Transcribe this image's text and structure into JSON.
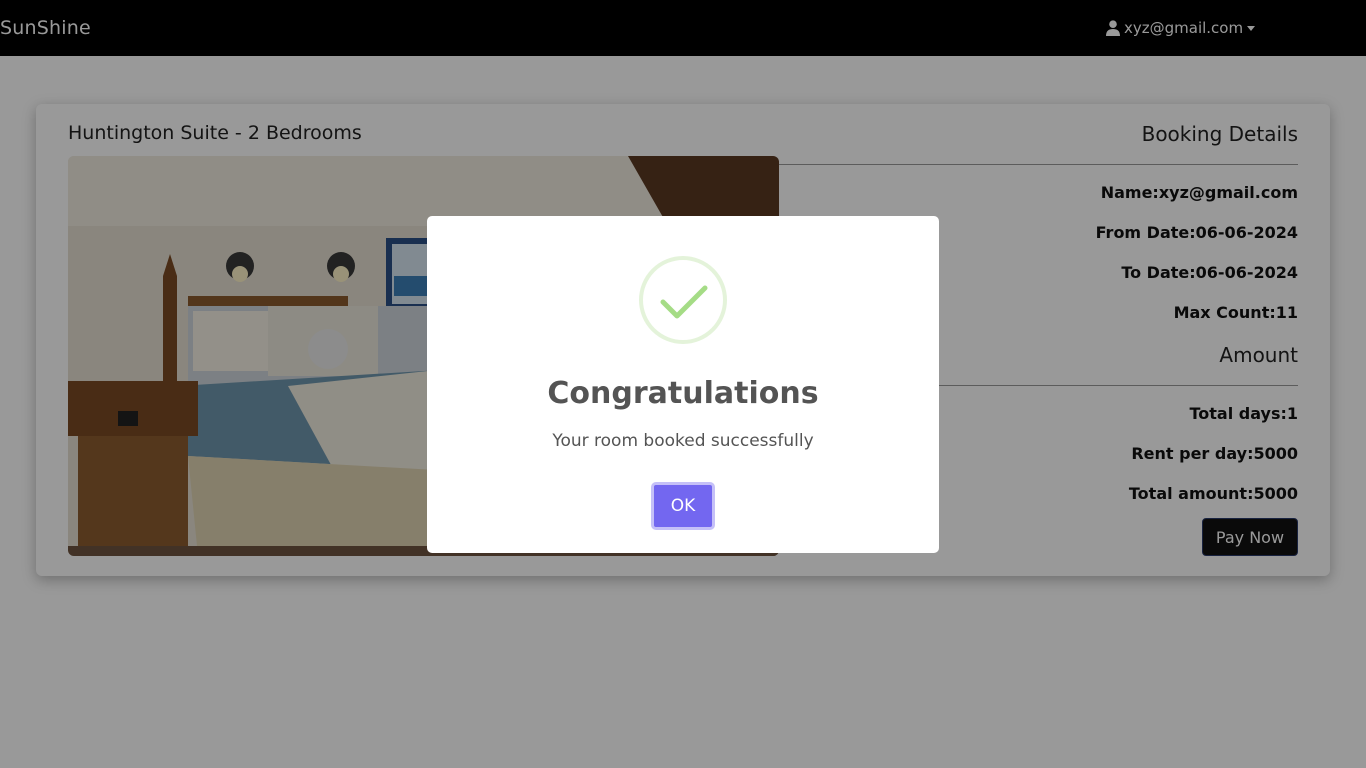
{
  "navbar": {
    "brand": "SunShine",
    "user_email": "xyz@gmail.com"
  },
  "room": {
    "title": "Huntington Suite - 2 Bedrooms"
  },
  "booking": {
    "title": "Booking Details",
    "name": "Name:xyz@gmail.com",
    "from_date": "From Date:06-06-2024",
    "to_date": "To Date:06-06-2024",
    "max_count": "Max Count:11"
  },
  "amount": {
    "title": "Amount",
    "total_days": "Total days:1",
    "rent_per_day": "Rent per day:5000",
    "total_amount": "Total amount:5000",
    "pay_label": "Pay Now"
  },
  "modal": {
    "title": "Congratulations",
    "message": "Your room booked successfully",
    "ok_label": "OK"
  },
  "colors": {
    "navbar": "#000000",
    "confirm_button": "#7367f0",
    "success_check": "#a5dc86"
  }
}
